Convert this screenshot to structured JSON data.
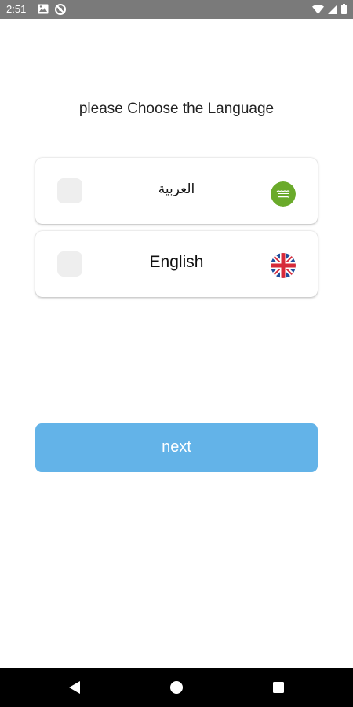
{
  "status_bar": {
    "time": "2:51",
    "left_icons": [
      "image-icon",
      "no-entry-icon"
    ],
    "right_icons": [
      "wifi-icon",
      "signal-icon",
      "battery-icon"
    ]
  },
  "title": "please Choose the Language",
  "languages": [
    {
      "label": "العربية",
      "flag": "saudi-arabia-flag-icon",
      "selected": false
    },
    {
      "label": "English",
      "flag": "united-kingdom-flag-icon",
      "selected": false
    }
  ],
  "next_button": {
    "label": "next"
  },
  "nav_bar": {
    "buttons": [
      "back-icon",
      "home-icon",
      "recents-icon"
    ]
  },
  "colors": {
    "status_bar": "#7a7a7a",
    "accent": "#63b3e8",
    "checkbox": "#eeeeee",
    "saudi_green": "#6aaa2a",
    "uk_blue": "#1f4e9c",
    "uk_red": "#d72a3a"
  }
}
